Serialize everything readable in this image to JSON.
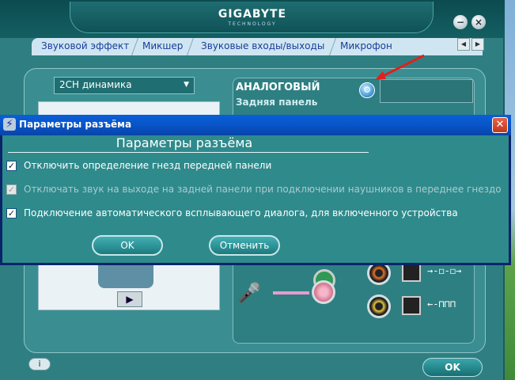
{
  "app": {
    "brand": "GIGABYTE",
    "brand_sub": "TECHNOLOGY",
    "tabs": [
      "Звуковой эффект",
      "Микшер",
      "Звуковые входы/выходы",
      "Микрофон"
    ],
    "speaker_mode": "2CH динамика",
    "analog_label": "АНАЛОГОВЫЙ",
    "rear_panel_label": "Задняя панель",
    "info_label": "i",
    "ok_label": "OK"
  },
  "dialog": {
    "title": "Параметры разъёма",
    "heading": "Параметры разъёма",
    "options": [
      {
        "label": "Отключить определение гнезд передней панели",
        "checked": true,
        "enabled": true
      },
      {
        "label": "Отключать звук на выходе на задней панели при подключении наушников в переднее гнездо",
        "checked": true,
        "enabled": false
      },
      {
        "label": "Подключение автоматического всплывающего диалога, для включенного устройства",
        "checked": true,
        "enabled": true
      }
    ],
    "ok_label": "OK",
    "cancel_label": "Отменить"
  },
  "icons": {
    "close": "close-icon",
    "minimize": "minimize-icon",
    "settings": "wrench-icon",
    "microphone": "microphone-icon",
    "play": "play-icon",
    "dialog_icon": "connector-icon"
  },
  "colors": {
    "dialog_title": "#0a5fd8",
    "panel": "#2f8a8c",
    "tab_text": "#1a3c9c",
    "arrow": "#e0201c"
  }
}
